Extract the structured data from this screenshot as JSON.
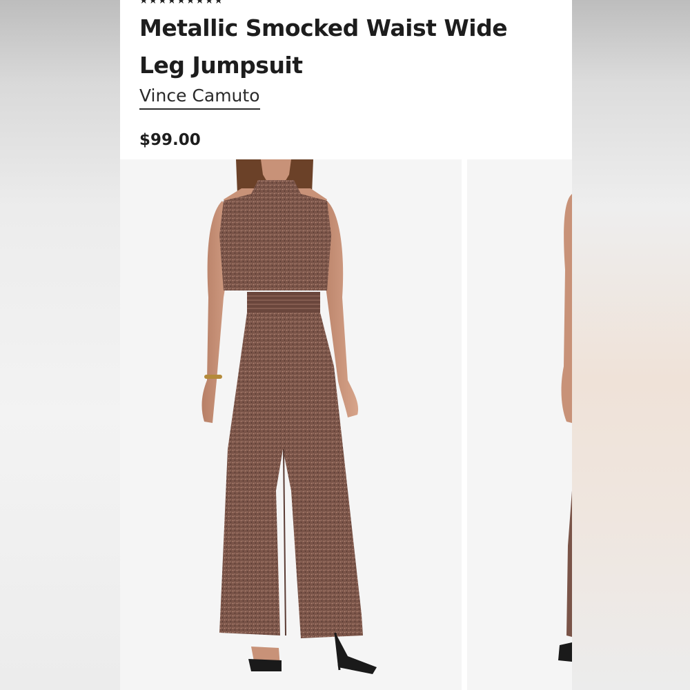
{
  "product": {
    "rating_stars": "★★★★★★★★★",
    "title": "Metallic Smocked Waist Wide Leg Jumpsuit",
    "brand": "Vince Camuto",
    "price": "$99.00"
  },
  "gallery": {
    "images": [
      {
        "label": "model-front-view"
      },
      {
        "label": "model-side-view"
      }
    ]
  },
  "colors": {
    "fabric": "#7a5448",
    "skin": "#c89278",
    "hair": "#6b4128",
    "background": "#f5f5f5"
  }
}
